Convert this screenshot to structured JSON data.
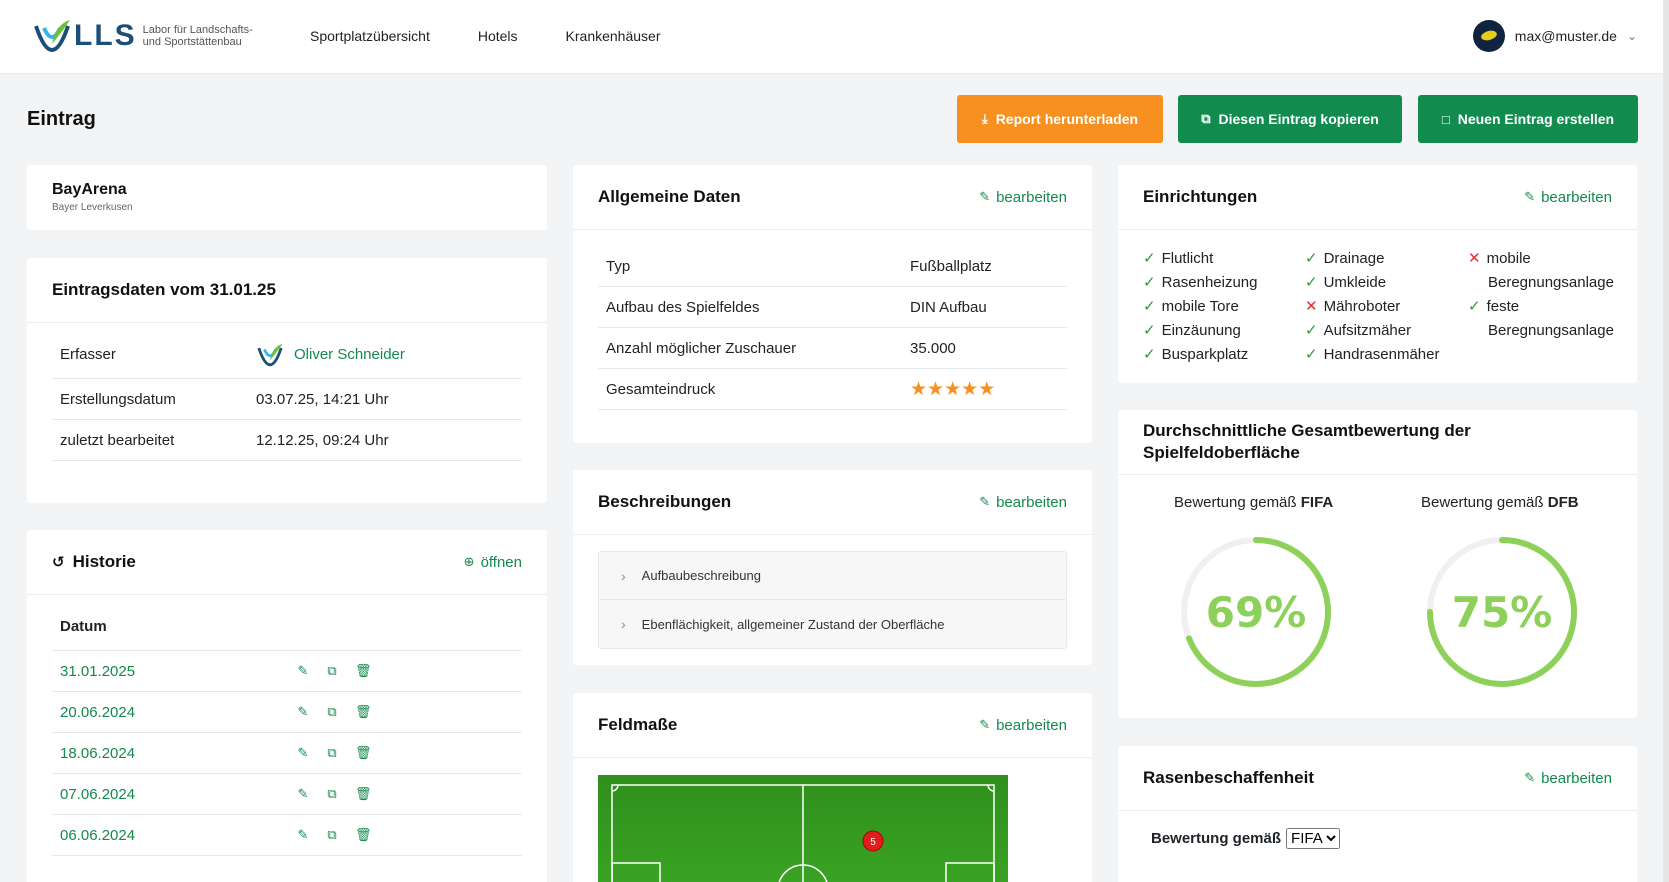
{
  "header": {
    "logo_text": "LLS",
    "logo_sub1": "Labor für Landschafts-",
    "logo_sub2": "und Sportstättenbau",
    "nav": [
      "Sportplatzübersicht",
      "Hotels",
      "Krankenhäuser"
    ],
    "user_email": "max@muster.de"
  },
  "page": {
    "title": "Eintrag",
    "btn_report": "Report herunterladen",
    "btn_copy": "Diesen Eintrag kopieren",
    "btn_new": "Neuen Eintrag erstellen"
  },
  "venue": {
    "name": "BayArena",
    "club": "Bayer Leverkusen"
  },
  "entry": {
    "title": "Eintragsdaten vom 31.01.25",
    "rows": [
      {
        "label": "Erfasser",
        "value": "Oliver Schneider"
      },
      {
        "label": "Erstellungsdatum",
        "value": "03.07.25, 14:21 Uhr"
      },
      {
        "label": "zuletzt bearbeitet",
        "value": "12.12.25, 09:24 Uhr"
      }
    ]
  },
  "history": {
    "title": "Historie",
    "open_label": "öffnen",
    "col_date": "Datum",
    "dates": [
      "31.01.2025",
      "20.06.2024",
      "18.06.2024",
      "07.06.2024",
      "06.06.2024"
    ]
  },
  "general": {
    "title": "Allgemeine Daten",
    "edit": "bearbeiten",
    "rows": [
      {
        "label": "Typ",
        "value": "Fußballplatz"
      },
      {
        "label": "Aufbau des Spielfeldes",
        "value": "DIN Aufbau"
      },
      {
        "label": "Anzahl möglicher Zuschauer",
        "value": "35.000"
      },
      {
        "label": "Gesamteindruck",
        "value": ""
      }
    ],
    "rating_stars": 5,
    "rating_color": "#f7901e"
  },
  "descriptions": {
    "title": "Beschreibungen",
    "edit": "bearbeiten",
    "items": [
      "Aufbaubeschreibung",
      "Ebenflächigkeit, allgemeiner Zustand der Oberfläche"
    ]
  },
  "field": {
    "title": "Feldmaße",
    "edit": "bearbeiten",
    "marker": "5"
  },
  "facilities": {
    "title": "Einrichtungen",
    "edit": "bearbeiten",
    "col1": [
      {
        "label": "Flutlicht",
        "ok": true
      },
      {
        "label": "Rasenheizung",
        "ok": true
      },
      {
        "label": "mobile Tore",
        "ok": true
      },
      {
        "label": "Einzäunung",
        "ok": true
      },
      {
        "label": "Busparkplatz",
        "ok": true
      }
    ],
    "col2": [
      {
        "label": "Drainage",
        "ok": true
      },
      {
        "label": "Umkleide",
        "ok": true
      },
      {
        "label": "Mähroboter",
        "ok": false
      },
      {
        "label": "Aufsitzmäher",
        "ok": true
      },
      {
        "label": "Handrasenmäher",
        "ok": true
      }
    ],
    "col3_a": "mobile",
    "col3_b": "Beregnungsanlage",
    "col3_c": "feste",
    "col3_d": "Beregnungsanlage"
  },
  "rating": {
    "title": "Durchschnittliche Gesamtbewertung der Spielfeldoberfläche",
    "fifa_prefix": "Bewertung gemäß ",
    "fifa_bold": "FIFA",
    "dfb_prefix": "Bewertung gemäß ",
    "dfb_bold": "DFB",
    "fifa_value": "69%",
    "dfb_value": "75%",
    "fifa_fraction": 0.69,
    "dfb_fraction": 0.75,
    "gauge_color": "#8dd15a"
  },
  "turf": {
    "title": "Rasenbeschaffenheit",
    "edit": "bearbeiten",
    "label": "Bewertung gemäß",
    "select_value": "FIFA"
  }
}
